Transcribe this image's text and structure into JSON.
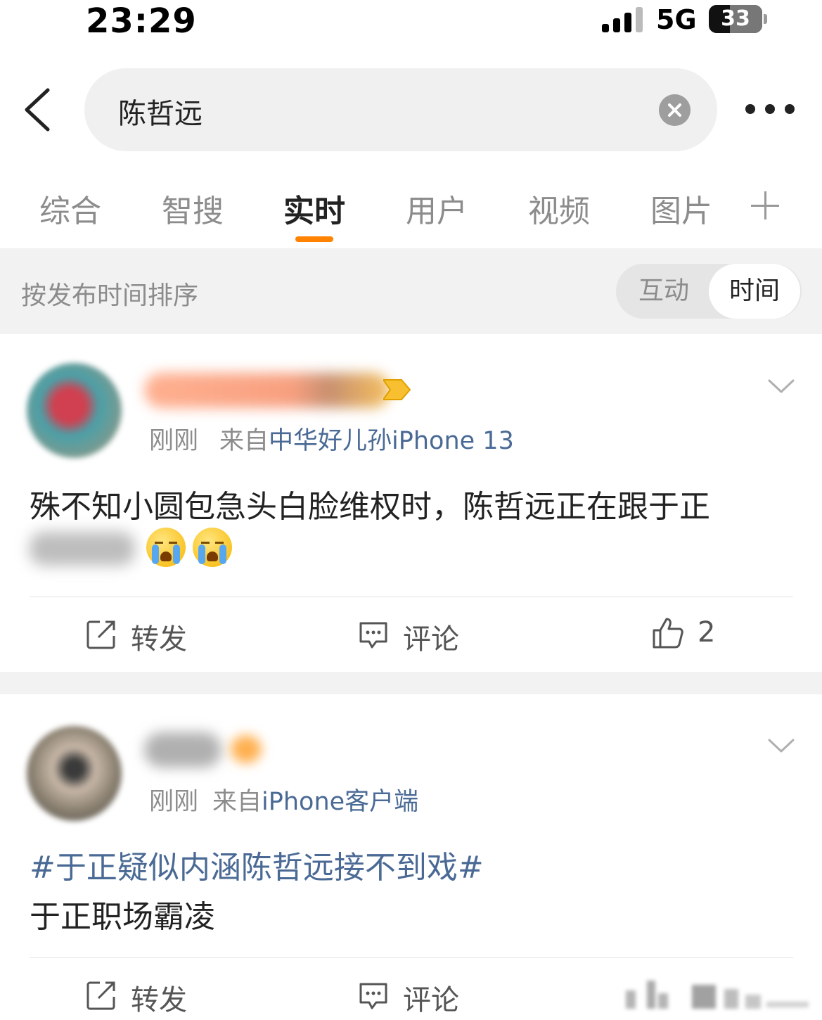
{
  "status_bar": {
    "time": "23:29",
    "network": "5G",
    "battery": "33"
  },
  "search": {
    "query": "陈哲远",
    "clear_icon": "clear-icon",
    "back_icon": "chevron-left-icon",
    "more_icon": "more-icon"
  },
  "tabs": [
    {
      "label": "综合",
      "active": false
    },
    {
      "label": "智搜",
      "active": false
    },
    {
      "label": "实时",
      "active": true
    },
    {
      "label": "用户",
      "active": false
    },
    {
      "label": "视频",
      "active": false
    },
    {
      "label": "图片",
      "active": false
    }
  ],
  "accent_color": "#ff8200",
  "link_color": "#4a6a95",
  "sort": {
    "label": "按发布时间排序",
    "options": [
      "互动",
      "时间"
    ],
    "selected": "时间"
  },
  "posts": [
    {
      "time": "刚刚",
      "source_prefix": "来自",
      "source": "中华好儿孙iPhone 13",
      "text_line1": "殊不知小圆包急头白脸维权时，陈哲远正在跟于正",
      "emoji": "crying-face-icon",
      "actions": {
        "repost": "转发",
        "comment": "评论",
        "like_count": "2"
      }
    },
    {
      "time": "刚刚",
      "source_prefix": "来自",
      "source": "iPhone客户端",
      "topic": "#于正疑似内涵陈哲远接不到戏#",
      "text_line2": "于正职场霸凌",
      "actions": {
        "repost": "转发",
        "comment": "评论"
      }
    }
  ]
}
